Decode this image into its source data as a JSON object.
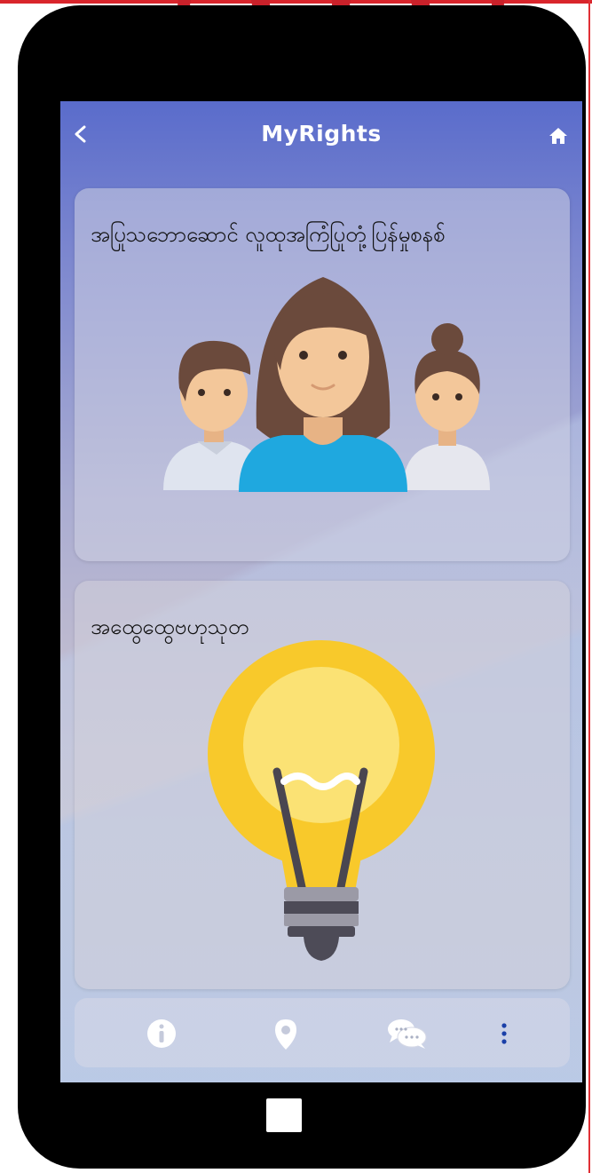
{
  "app": {
    "title": "MyRights"
  },
  "cards": [
    {
      "title": "အပြုသဘောဆောင် လူထုအကြံပြုတုံ့ပြန်မှုစနစ်",
      "illustration": "people-family-icon"
    },
    {
      "title": "အထွေထွေဗဟုသုတ",
      "illustration": "light-bulb-icon"
    }
  ],
  "bottom_nav": [
    {
      "icon": "info-icon"
    },
    {
      "icon": "location-pin-icon"
    },
    {
      "icon": "chat-icon"
    },
    {
      "icon": "more-vertical-icon"
    }
  ],
  "colors": {
    "primary": "#5a6ccb",
    "accent_red": "#d9252c",
    "bulb_yellow": "#f8c92b"
  }
}
